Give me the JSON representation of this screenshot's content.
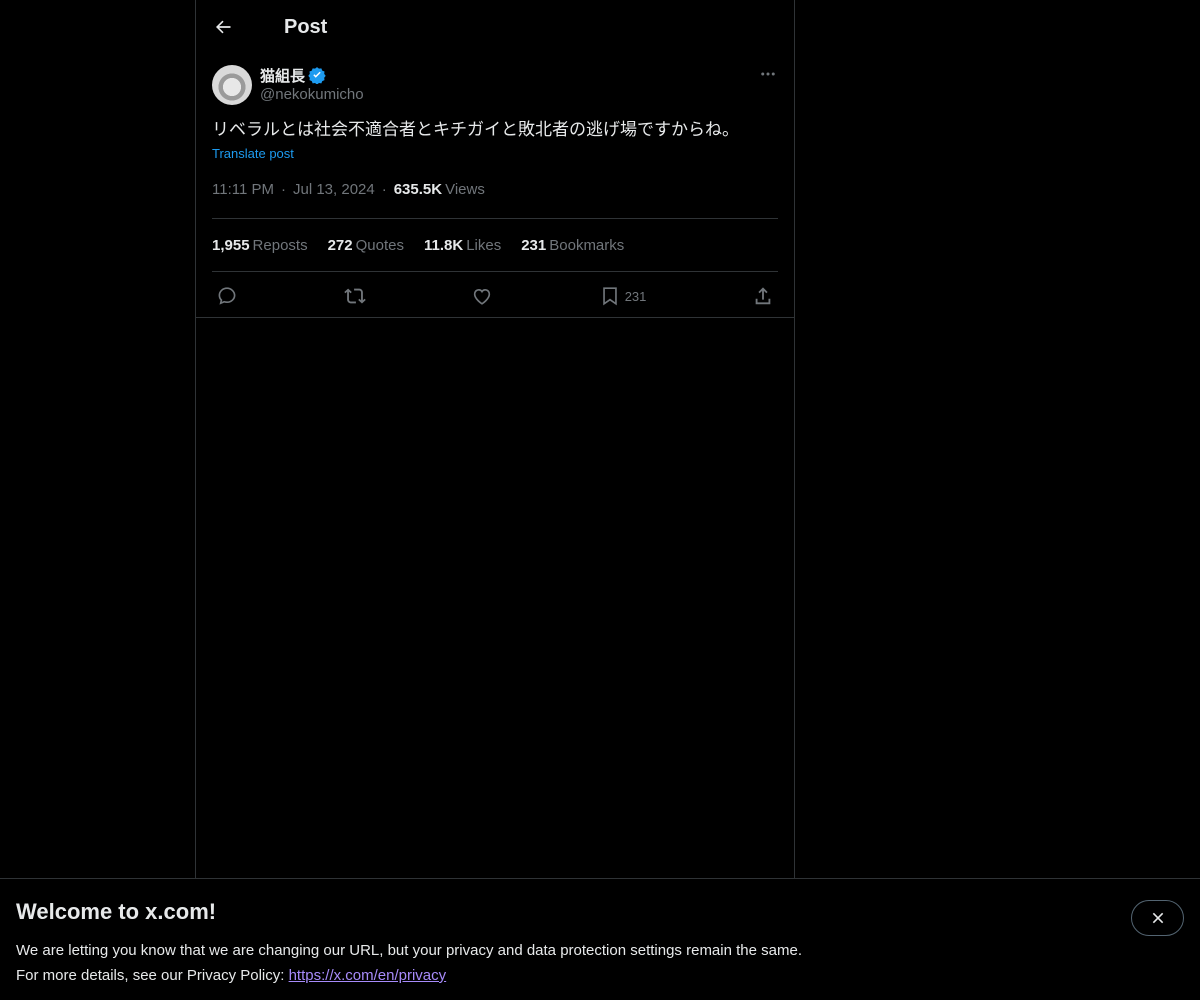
{
  "header": {
    "title": "Post"
  },
  "post": {
    "author": {
      "display_name": "猫組長",
      "handle": "@nekokumicho",
      "verified": true
    },
    "text": "リベラルとは社会不適合者とキチガイと敗北者の逃げ場ですからね。",
    "translate_label": "Translate post",
    "time": "11:11 PM",
    "date": "Jul 13, 2024",
    "views_count": "635.5K",
    "views_label": "Views",
    "stats": [
      {
        "count": "1,955",
        "label": "Reposts"
      },
      {
        "count": "272",
        "label": "Quotes"
      },
      {
        "count": "11.8K",
        "label": "Likes"
      },
      {
        "count": "231",
        "label": "Bookmarks"
      }
    ],
    "actions": {
      "bookmark_count": "231"
    }
  },
  "banner": {
    "title": "Welcome to x.com!",
    "line1": "We are letting you know that we are changing our URL, but your privacy and data protection settings remain the same.",
    "line2_prefix": "For more details, see our Privacy Policy: ",
    "link_text": "https://x.com/en/privacy"
  },
  "colors": {
    "accent": "#1d9bf0",
    "muted": "#71767b",
    "border": "#2f3336",
    "link": "#a78bfa"
  }
}
